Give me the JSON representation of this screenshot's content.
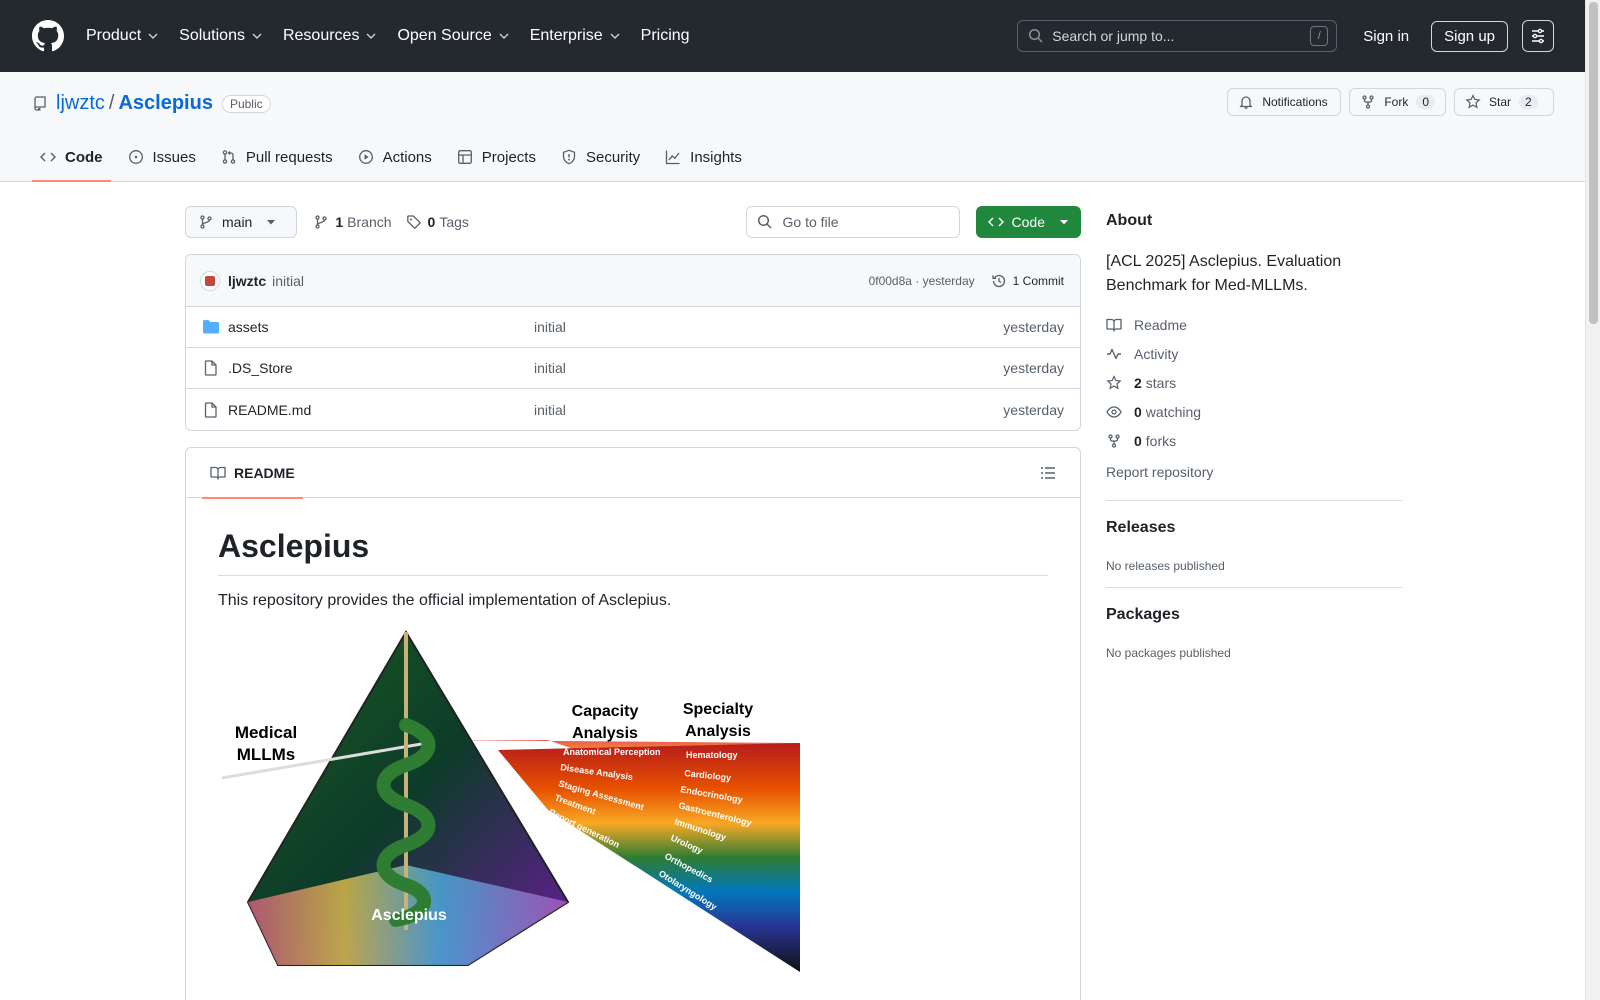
{
  "global_nav": {
    "items": [
      "Product",
      "Solutions",
      "Resources",
      "Open Source",
      "Enterprise",
      "Pricing"
    ],
    "search_placeholder": "Search or jump to...",
    "search_shortcut": "/",
    "sign_in": "Sign in",
    "sign_up": "Sign up"
  },
  "repo": {
    "owner": "ljwztc",
    "separator": "/",
    "name": "Asclepius",
    "visibility": "Public",
    "notifications_label": "Notifications",
    "fork_label": "Fork",
    "fork_count": "0",
    "star_label": "Star",
    "star_count": "2",
    "tabs": [
      "Code",
      "Issues",
      "Pull requests",
      "Actions",
      "Projects",
      "Security",
      "Insights"
    ]
  },
  "toolbar": {
    "branch": "main",
    "branch_count": "1",
    "branch_label": "Branch",
    "tag_count": "0",
    "tag_label": "Tags",
    "goto_placeholder": "Go to file",
    "code_label": "Code"
  },
  "commit": {
    "author": "ljwztc",
    "message": "initial",
    "hash_time": "0f00d8a · yesterday",
    "count_label": "1 Commit"
  },
  "files": [
    {
      "name": "assets",
      "message": "initial",
      "date": "yesterday",
      "type": "dir"
    },
    {
      "name": ".DS_Store",
      "message": "initial",
      "date": "yesterday",
      "type": "file"
    },
    {
      "name": "README.md",
      "message": "initial",
      "date": "yesterday",
      "type": "file"
    }
  ],
  "readme": {
    "tab_label": "README",
    "title": "Asclepius",
    "description": "This repository provides the official implementation of Asclepius.",
    "figure": {
      "left_label_1": "Medical",
      "left_label_2": "MLLMs",
      "center_label": "Asclepius",
      "capacity_h1": "Capacity",
      "capacity_h2": "Analysis",
      "specialty_h1": "Specialty",
      "specialty_h2": "Analysis",
      "capacity_items": [
        "Anatomical Perception",
        "Disease Analysis",
        "Staging Assessment",
        "Treatment",
        "Report generation"
      ],
      "specialty_items": [
        "Hematology",
        "Cardiology",
        "Endocrinology",
        "Gastroenterology",
        "Immunology",
        "Urology",
        "Orthopedics",
        "Otolaryngology"
      ]
    }
  },
  "sidebar": {
    "about_title": "About",
    "about_desc": "[ACL 2025] Asclepius. Evaluation Benchmark for Med-MLLMs.",
    "readme_link": "Readme",
    "activity_link": "Activity",
    "stars_count": "2",
    "stars_label": "stars",
    "watching_count": "0",
    "watching_label": "watching",
    "forks_count": "0",
    "forks_label": "forks",
    "report_link": "Report repository",
    "releases_title": "Releases",
    "releases_note": "No releases published",
    "packages_title": "Packages",
    "packages_note": "No packages published"
  },
  "colors": {
    "header_bg": "#24292f",
    "link": "#0969da",
    "primary_green": "#1f883d",
    "tab_underline": "#fd8c73"
  }
}
